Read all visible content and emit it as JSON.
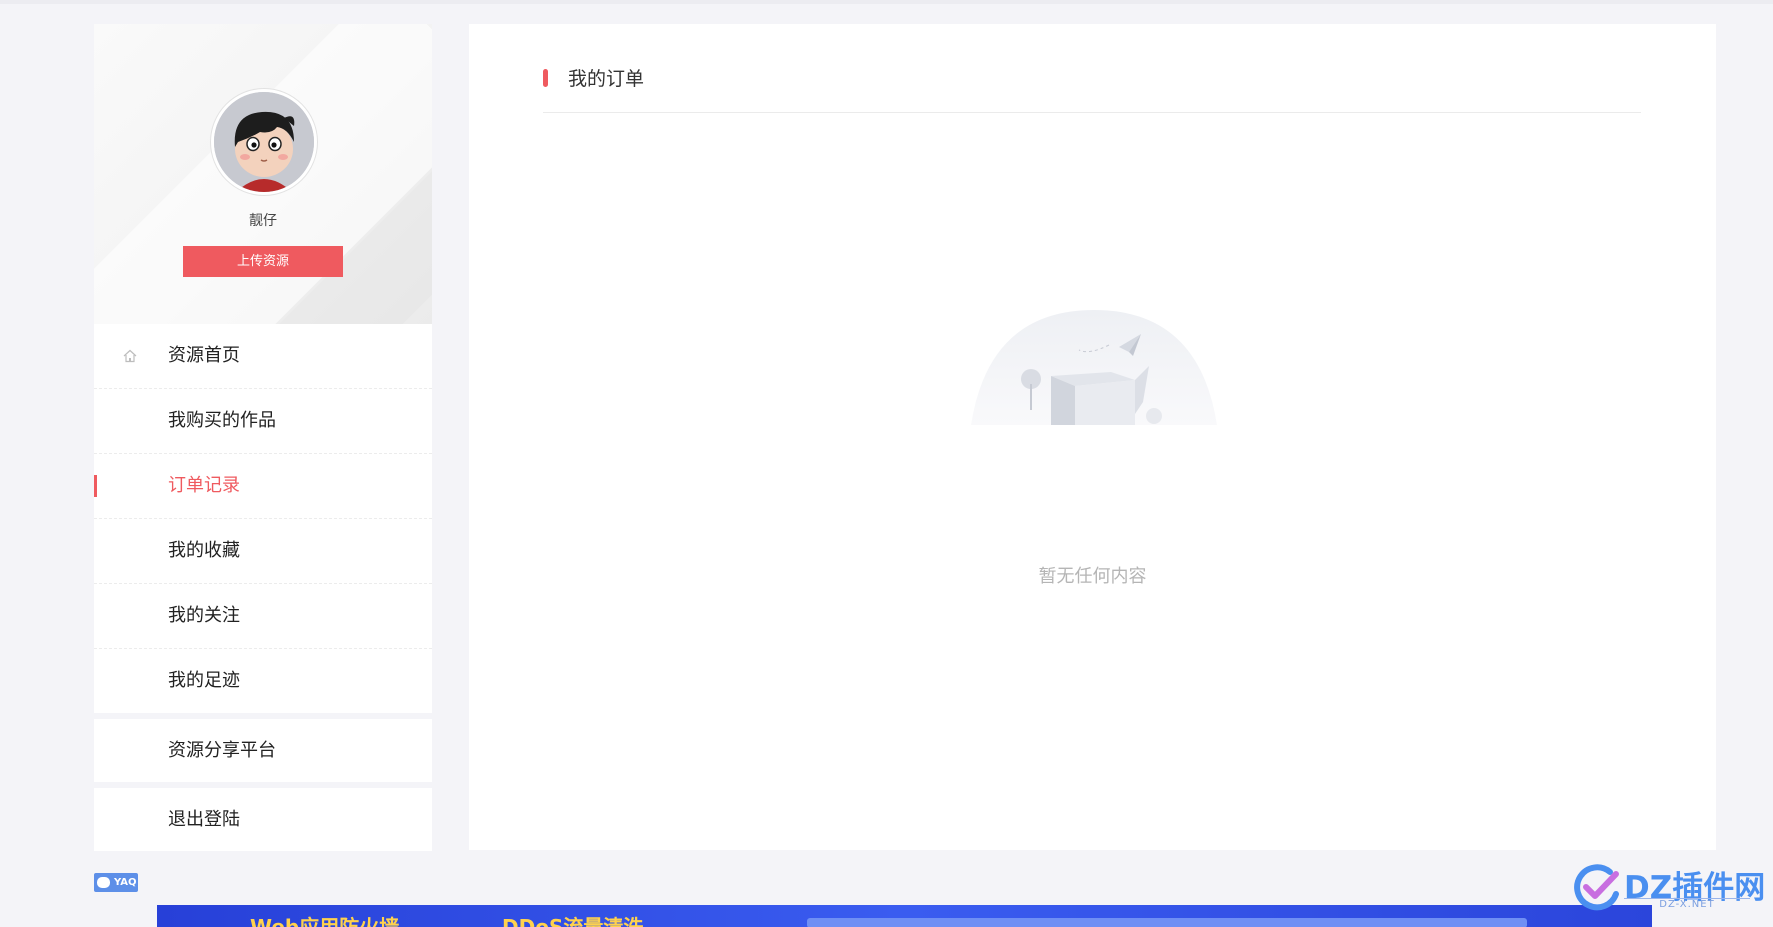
{
  "sidebar": {
    "username": "靓仔",
    "upload_label": "上传资源",
    "menu": [
      {
        "label": "资源首页",
        "icon": "home-icon"
      },
      {
        "label": "我购买的作品"
      },
      {
        "label": "订单记录",
        "active": true
      },
      {
        "label": "我的收藏"
      },
      {
        "label": "我的关注"
      },
      {
        "label": "我的足迹"
      }
    ],
    "share_platform": "资源分享平台",
    "logout": "退出登陆"
  },
  "main": {
    "section_title": "我的订单",
    "empty_text": "暂无任何内容"
  },
  "footer": {
    "badge": "YAQ",
    "ad_items": [
      "Web应用防火墙",
      "DDoS流量清洗"
    ]
  },
  "watermark": {
    "brand": "DZ插件网",
    "domain": "DZ-X.NET"
  },
  "colors": {
    "accent": "#ef5a5f",
    "page_bg": "#f4f4f8",
    "watermark": "#4a8ff0"
  }
}
